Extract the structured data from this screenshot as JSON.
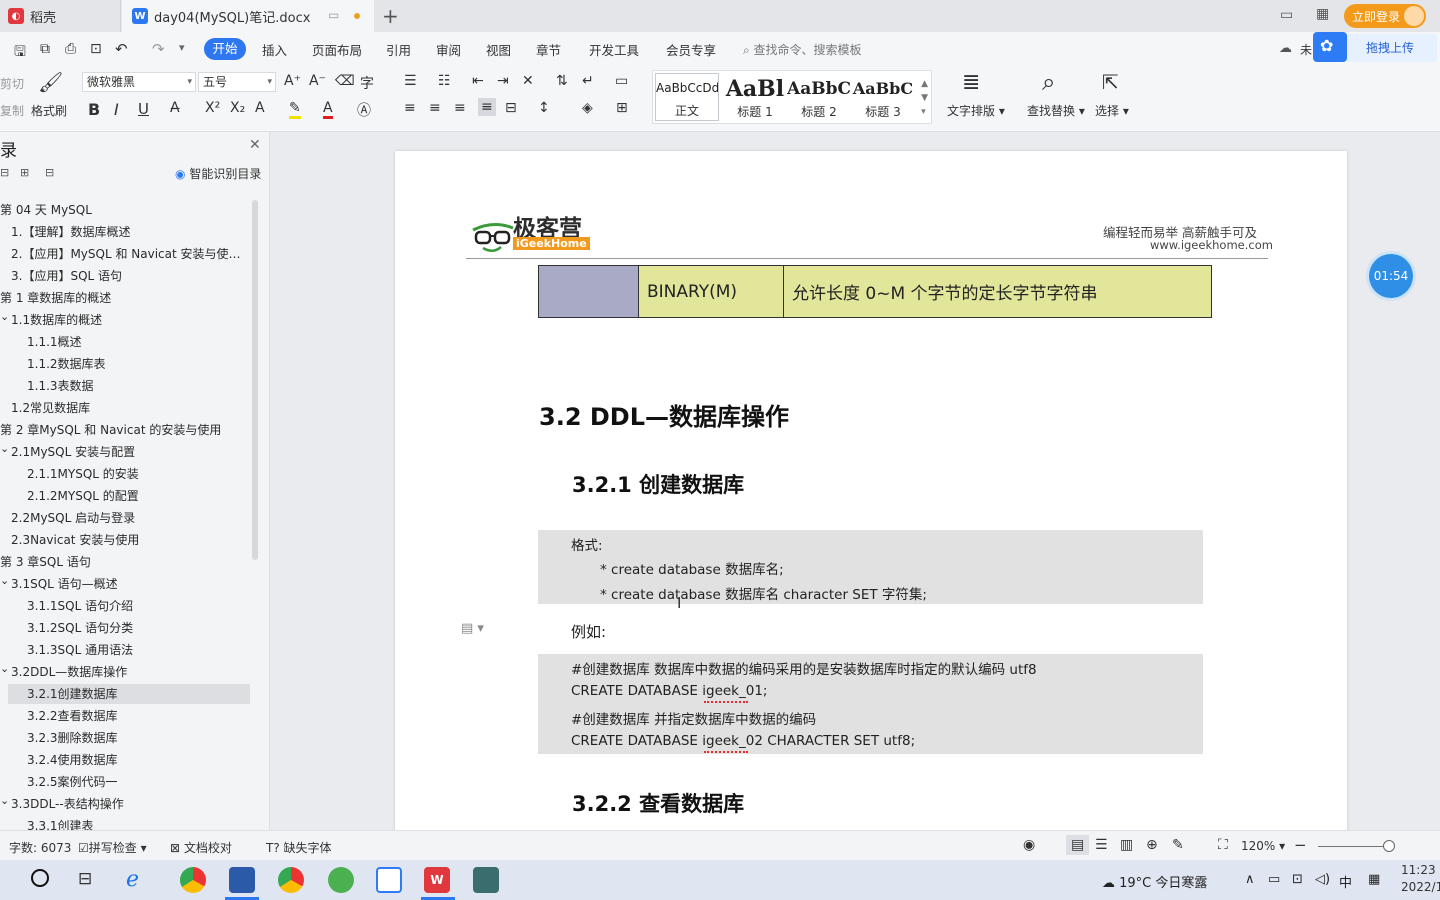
{
  "tabs": {
    "home_label": "稻壳",
    "doc_label": "day04(MySQL)笔记.docx",
    "add": "+",
    "login": "立即登录"
  },
  "menu": {
    "items": [
      "开始",
      "插入",
      "页面布局",
      "引用",
      "审阅",
      "视图",
      "章节",
      "开发工具",
      "会员专享"
    ],
    "search": "查找命令、搜索模板",
    "unsaved": "未",
    "upload": "拖拽上传"
  },
  "toolbar": {
    "cut": "剪切",
    "copy": "复制",
    "format_painter": "格式刷",
    "font_name": "微软雅黑",
    "font_size": "五号",
    "styles": [
      {
        "sample": "AaBbCcDd",
        "label": "正文"
      },
      {
        "sample": "AaBl",
        "label": "标题 1"
      },
      {
        "sample": "AaBbC",
        "label": "标题 2"
      },
      {
        "sample": "AaBbC",
        "label": "标题 3"
      }
    ],
    "text_layout": "文字排版",
    "find_replace": "查找替换",
    "select": "选择"
  },
  "sidebar": {
    "title": "录",
    "smart_toc": "智能识别目录",
    "items": [
      {
        "label": "第 04 天 MySQL",
        "level": 0,
        "active": false
      },
      {
        "label": "1.【理解】数据库概述",
        "level": 1,
        "active": false
      },
      {
        "label": "2.【应用】MySQL 和 Navicat 安装与使…",
        "level": 1,
        "active": false
      },
      {
        "label": "3.【应用】SQL 语句",
        "level": 1,
        "active": false
      },
      {
        "label": "第 1 章数据库的概述",
        "level": 0,
        "active": false
      },
      {
        "label": "1.1数据库的概述",
        "level": 1,
        "active": false,
        "caret": true
      },
      {
        "label": "1.1.1概述",
        "level": 2,
        "active": false
      },
      {
        "label": "1.1.2数据库表",
        "level": 2,
        "active": false
      },
      {
        "label": "1.1.3表数据",
        "level": 2,
        "active": false
      },
      {
        "label": "1.2常见数据库",
        "level": 1,
        "active": false
      },
      {
        "label": "第 2 章MySQL 和 Navicat 的安装与使用",
        "level": 0,
        "active": false
      },
      {
        "label": "2.1MySQL 安装与配置",
        "level": 1,
        "active": false,
        "caret": true
      },
      {
        "label": "2.1.1MYSQL 的安装",
        "level": 2,
        "active": false
      },
      {
        "label": "2.1.2MYSQL 的配置",
        "level": 2,
        "active": false
      },
      {
        "label": "2.2MySQL 启动与登录",
        "level": 1,
        "active": false
      },
      {
        "label": "2.3Navicat 安装与使用",
        "level": 1,
        "active": false
      },
      {
        "label": "第 3 章SQL 语句",
        "level": 0,
        "active": false
      },
      {
        "label": "3.1SQL 语句—概述",
        "level": 1,
        "active": false,
        "caret": true
      },
      {
        "label": "3.1.1SQL 语句介绍",
        "level": 2,
        "active": false
      },
      {
        "label": "3.1.2SQL 语句分类",
        "level": 2,
        "active": false
      },
      {
        "label": "3.1.3SQL 通用语法",
        "level": 2,
        "active": false
      },
      {
        "label": "3.2DDL—数据库操作",
        "level": 1,
        "active": false,
        "caret": true
      },
      {
        "label": "3.2.1创建数据库",
        "level": 2,
        "active": true
      },
      {
        "label": "3.2.2查看数据库",
        "level": 2,
        "active": false
      },
      {
        "label": "3.2.3删除数据库",
        "level": 2,
        "active": false
      },
      {
        "label": "3.2.4使用数据库",
        "level": 2,
        "active": false
      },
      {
        "label": "3.2.5案例代码一",
        "level": 2,
        "active": false
      },
      {
        "label": "3.3DDL--表结构操作",
        "level": 1,
        "active": false,
        "caret": true
      },
      {
        "label": "3.3.1创建表",
        "level": 2,
        "active": false
      }
    ]
  },
  "document": {
    "logo_cn": "极客营",
    "logo_en": "iGeekHome",
    "slogan": "编程轻而易举  高薪触手可及",
    "url": "www.igeekhome.com",
    "table_row": {
      "type": "BINARY(M)",
      "desc": "允许长度 0~M 个字节的定长字节字符串"
    },
    "h_32": "3.2 DDL—数据库操作",
    "h_321": "3.2.1 创建数据库",
    "format_block": {
      "title": "格式:",
      "lines": [
        "* create database  数据库名;",
        "* create database  数据库名  character SET  字符集;"
      ]
    },
    "example_label": "例如:",
    "example_block": [
      "#创建数据库  数据库中数据的编码采用的是安装数据库时指定的默认编码  utf8",
      "CREATE DATABASE igeek_01;",
      "#创建数据库  并指定数据库中数据的编码",
      "CREATE DATABASE igeek_02 CHARACTER SET utf8;"
    ],
    "h_322": "3.2.2 查看数据库"
  },
  "timer": "01:54",
  "status": {
    "word_count": "字数: 6073",
    "spell_check": "拼写检查",
    "doc_proof": "文档校对",
    "missing_font": "缺失字体",
    "zoom": "120%"
  },
  "taskbar": {
    "weather": "19°C  今日寒露",
    "ime": "中",
    "time": "11:23",
    "date": "2022/1"
  },
  "colors": {
    "accent": "#2d77f0",
    "table_gray": "#a9abc6",
    "table_yellow": "#e2e69a",
    "code_bg": "#e1e1e1"
  }
}
